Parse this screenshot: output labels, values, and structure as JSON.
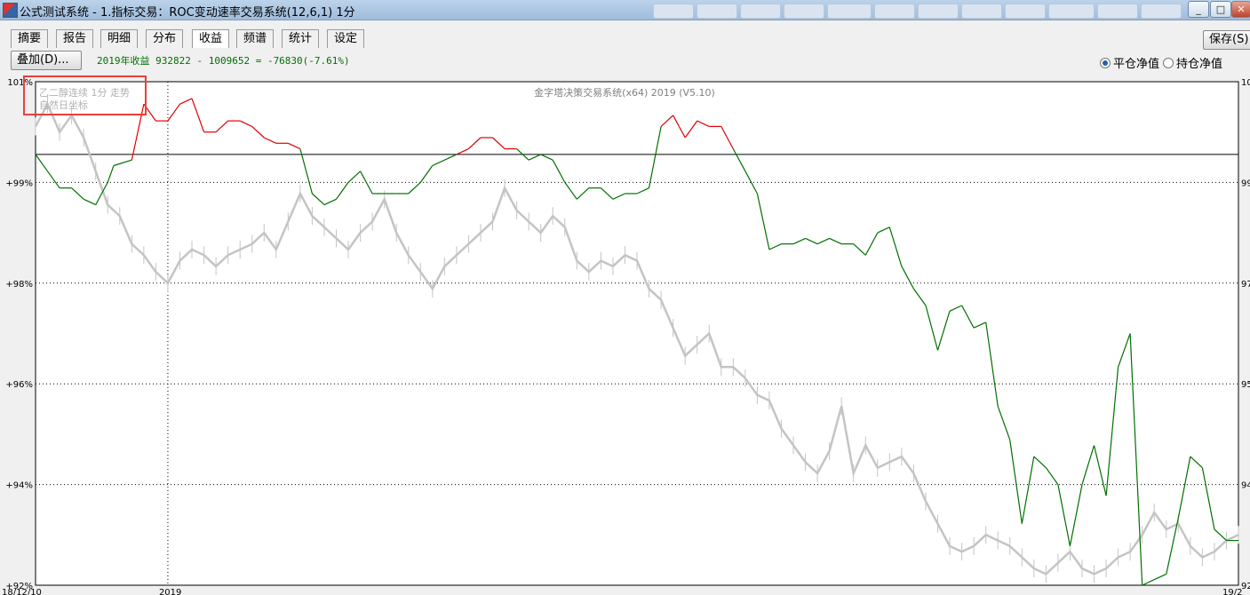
{
  "window": {
    "title": "公式测试系统 - 1.指标交易：ROC变动速率交易系统(12,6,1) 1分",
    "min_label": "_",
    "max_label": "□",
    "close_label": "✕"
  },
  "tabs": [
    {
      "label": "摘要"
    },
    {
      "label": "报告"
    },
    {
      "label": "明细"
    },
    {
      "label": "分布"
    },
    {
      "label": "收益",
      "active": true
    },
    {
      "label": "频谱"
    },
    {
      "label": "统计"
    },
    {
      "label": "设定"
    }
  ],
  "toolbar": {
    "overlay_label": "叠加(D)...",
    "save_label": "保存(S)",
    "summary_text": "2019年收益 932822 - 1009652 = -76830(-7.61%)",
    "radio_close_label": "平仓净值",
    "radio_hold_label": "持仓净值",
    "selected_radio": "平仓净值"
  },
  "colors": {
    "profit_line": "#e00000",
    "loss_line": "#007000",
    "price_line": "#c4c4c4",
    "highlight_box": "#e8403a",
    "accent_text": "#007000"
  },
  "chart_data": {
    "type": "line",
    "title": "金字塔决策交易系统(x64) 2019 (V5.10)",
    "legend_line1": "乙二醇连续 1分 走势",
    "legend_line2": "自然日坐标",
    "left_axis": {
      "ticks": [
        "101%",
        "+99%",
        "+98%",
        "+96%",
        "+94%",
        "+92%"
      ],
      "ylim": [
        92,
        101
      ]
    },
    "right_axis": {
      "ticks": [
        "10",
        "99",
        "97",
        "95",
        "94",
        "92"
      ]
    },
    "baseline_percent": 99.7,
    "x_labels": [
      "18/12/10",
      "2019",
      "19/2"
    ],
    "year_marker_x": 0.11,
    "series": [
      {
        "kind": "equity",
        "x": [
          0,
          0.01,
          0.02,
          0.03,
          0.04,
          0.05,
          0.06,
          0.065,
          0.08,
          0.085,
          0.09,
          0.1,
          0.11,
          0.12,
          0.13,
          0.14,
          0.15,
          0.16,
          0.17,
          0.18,
          0.19,
          0.2,
          0.21,
          0.22,
          0.23,
          0.24,
          0.25,
          0.26,
          0.27,
          0.28,
          0.29,
          0.3,
          0.31,
          0.32,
          0.33,
          0.34,
          0.35,
          0.36,
          0.37,
          0.38,
          0.39,
          0.4,
          0.41,
          0.42,
          0.43,
          0.44,
          0.45,
          0.46,
          0.47,
          0.48,
          0.49,
          0.5,
          0.51,
          0.52,
          0.53,
          0.54,
          0.55,
          0.56,
          0.57,
          0.58,
          0.59,
          0.6,
          0.61,
          0.62,
          0.63,
          0.64,
          0.65,
          0.66,
          0.67,
          0.68,
          0.69,
          0.7,
          0.71,
          0.72,
          0.73,
          0.74,
          0.75,
          0.76,
          0.77,
          0.78,
          0.79,
          0.8,
          0.81,
          0.82,
          0.83,
          0.84,
          0.85,
          0.86,
          0.87,
          0.88,
          0.89,
          0.9,
          0.91,
          0.92,
          0.93,
          0.94,
          0.95,
          0.96,
          0.97,
          0.98,
          0.99,
          1.0
        ],
        "y": [
          99.7,
          99.4,
          99.1,
          99.1,
          98.9,
          98.8,
          99.2,
          99.5,
          99.6,
          100.1,
          100.6,
          100.3,
          100.3,
          100.6,
          100.7,
          100.1,
          100.1,
          100.3,
          100.3,
          100.2,
          100.0,
          99.9,
          99.9,
          99.8,
          99.0,
          98.8,
          98.9,
          99.2,
          99.4,
          99.0,
          99.0,
          99.0,
          99.0,
          99.2,
          99.5,
          99.6,
          99.7,
          99.8,
          100.0,
          100.0,
          99.8,
          99.8,
          99.6,
          99.7,
          99.6,
          99.2,
          98.9,
          99.1,
          99.1,
          98.9,
          99.0,
          99.0,
          99.1,
          100.2,
          100.4,
          100.0,
          100.3,
          100.2,
          100.2,
          99.8,
          99.4,
          99.0,
          98.0,
          98.1,
          98.1,
          98.2,
          98.1,
          98.2,
          98.1,
          98.1,
          97.9,
          98.3,
          98.4,
          97.7,
          97.3,
          97.0,
          96.2,
          96.9,
          97.0,
          96.6,
          96.7,
          95.2,
          94.6,
          93.1,
          94.3,
          94.1,
          93.8,
          92.7,
          93.8,
          94.5,
          93.6,
          95.9,
          96.5,
          92.0,
          92.1,
          92.2,
          93.2,
          94.3,
          94.1,
          93.0,
          92.8,
          92.8
        ]
      },
      {
        "kind": "price",
        "x": [
          0,
          0.01,
          0.02,
          0.03,
          0.04,
          0.05,
          0.06,
          0.07,
          0.08,
          0.09,
          0.1,
          0.11,
          0.12,
          0.13,
          0.14,
          0.15,
          0.16,
          0.17,
          0.18,
          0.19,
          0.2,
          0.21,
          0.22,
          0.23,
          0.24,
          0.25,
          0.26,
          0.27,
          0.28,
          0.29,
          0.3,
          0.31,
          0.32,
          0.33,
          0.34,
          0.35,
          0.36,
          0.37,
          0.38,
          0.39,
          0.4,
          0.41,
          0.42,
          0.43,
          0.44,
          0.45,
          0.46,
          0.47,
          0.48,
          0.49,
          0.5,
          0.51,
          0.52,
          0.53,
          0.54,
          0.55,
          0.56,
          0.57,
          0.58,
          0.59,
          0.6,
          0.61,
          0.62,
          0.63,
          0.64,
          0.65,
          0.66,
          0.67,
          0.68,
          0.69,
          0.7,
          0.71,
          0.72,
          0.73,
          0.74,
          0.75,
          0.76,
          0.77,
          0.78,
          0.79,
          0.8,
          0.81,
          0.82,
          0.83,
          0.84,
          0.85,
          0.86,
          0.87,
          0.88,
          0.89,
          0.9,
          0.91,
          0.92,
          0.93,
          0.94,
          0.95,
          0.96,
          0.97,
          0.98,
          0.99,
          1.0
        ],
        "y": [
          100.2,
          100.6,
          100.1,
          100.4,
          100.0,
          99.4,
          98.8,
          98.6,
          98.1,
          97.9,
          97.6,
          97.4,
          97.8,
          98.0,
          97.9,
          97.7,
          97.9,
          98.0,
          98.1,
          98.3,
          98.0,
          98.5,
          99.0,
          98.6,
          98.4,
          98.2,
          98.0,
          98.3,
          98.5,
          98.9,
          98.3,
          97.9,
          97.6,
          97.3,
          97.7,
          97.9,
          98.1,
          98.3,
          98.5,
          99.1,
          98.7,
          98.5,
          98.3,
          98.6,
          98.4,
          97.8,
          97.6,
          97.8,
          97.7,
          97.9,
          97.8,
          97.3,
          97.1,
          96.6,
          96.1,
          96.3,
          96.5,
          95.9,
          95.9,
          95.7,
          95.4,
          95.3,
          94.8,
          94.5,
          94.2,
          94.0,
          94.4,
          95.2,
          94.0,
          94.5,
          94.1,
          94.2,
          94.3,
          94.0,
          93.5,
          93.1,
          92.7,
          92.6,
          92.7,
          92.9,
          92.8,
          92.7,
          92.5,
          92.3,
          92.2,
          92.4,
          92.6,
          92.3,
          92.2,
          92.3,
          92.5,
          92.6,
          92.9,
          93.3,
          93.0,
          93.1,
          92.7,
          92.5,
          92.6,
          92.8,
          92.9
        ]
      }
    ]
  }
}
